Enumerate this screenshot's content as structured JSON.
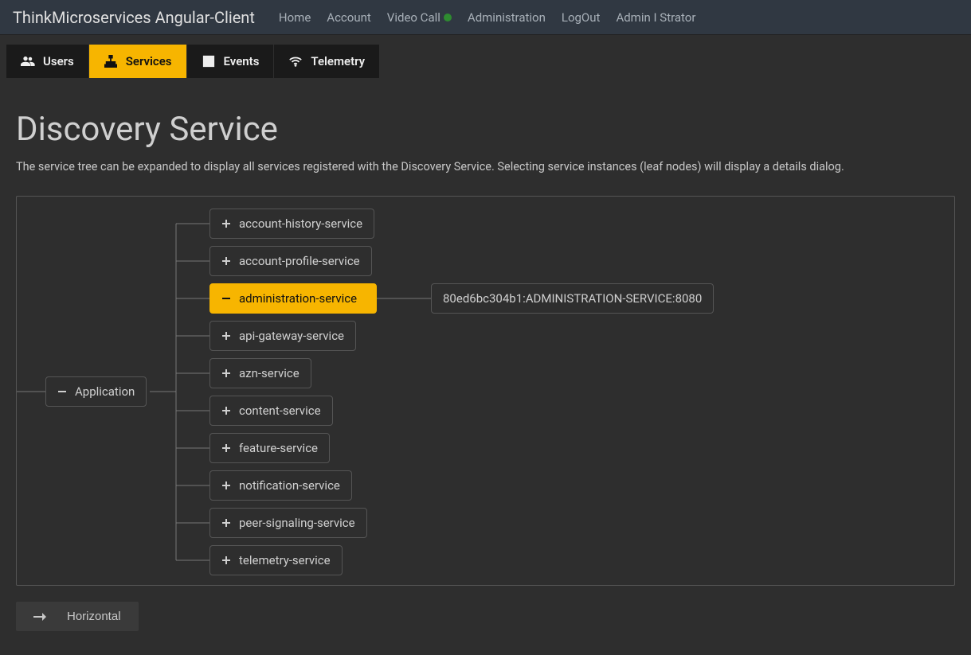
{
  "header": {
    "brand": "ThinkMicroservices Angular-Client",
    "nav": {
      "home": "Home",
      "account": "Account",
      "video_call": "Video Call",
      "administration": "Administration",
      "logout": "LogOut",
      "user": "Admin I Strator"
    }
  },
  "tabs": {
    "users": "Users",
    "services": "Services",
    "events": "Events",
    "telemetry": "Telemetry"
  },
  "page": {
    "title": "Discovery Service",
    "description": "The service tree can be expanded to display all services registered with the Discovery Service. Selecting service instances (leaf nodes) will display a details dialog."
  },
  "tree": {
    "root": "Application",
    "services": [
      "account-history-service",
      "account-profile-service",
      "administration-service",
      "api-gateway-service",
      "azn-service",
      "content-service",
      "feature-service",
      "notification-service",
      "peer-signaling-service",
      "telemetry-service"
    ],
    "selected_index": 2,
    "instance": "80ed6bc304b1:ADMINISTRATION-SERVICE:8080"
  },
  "orientation_button": "Horizontal"
}
